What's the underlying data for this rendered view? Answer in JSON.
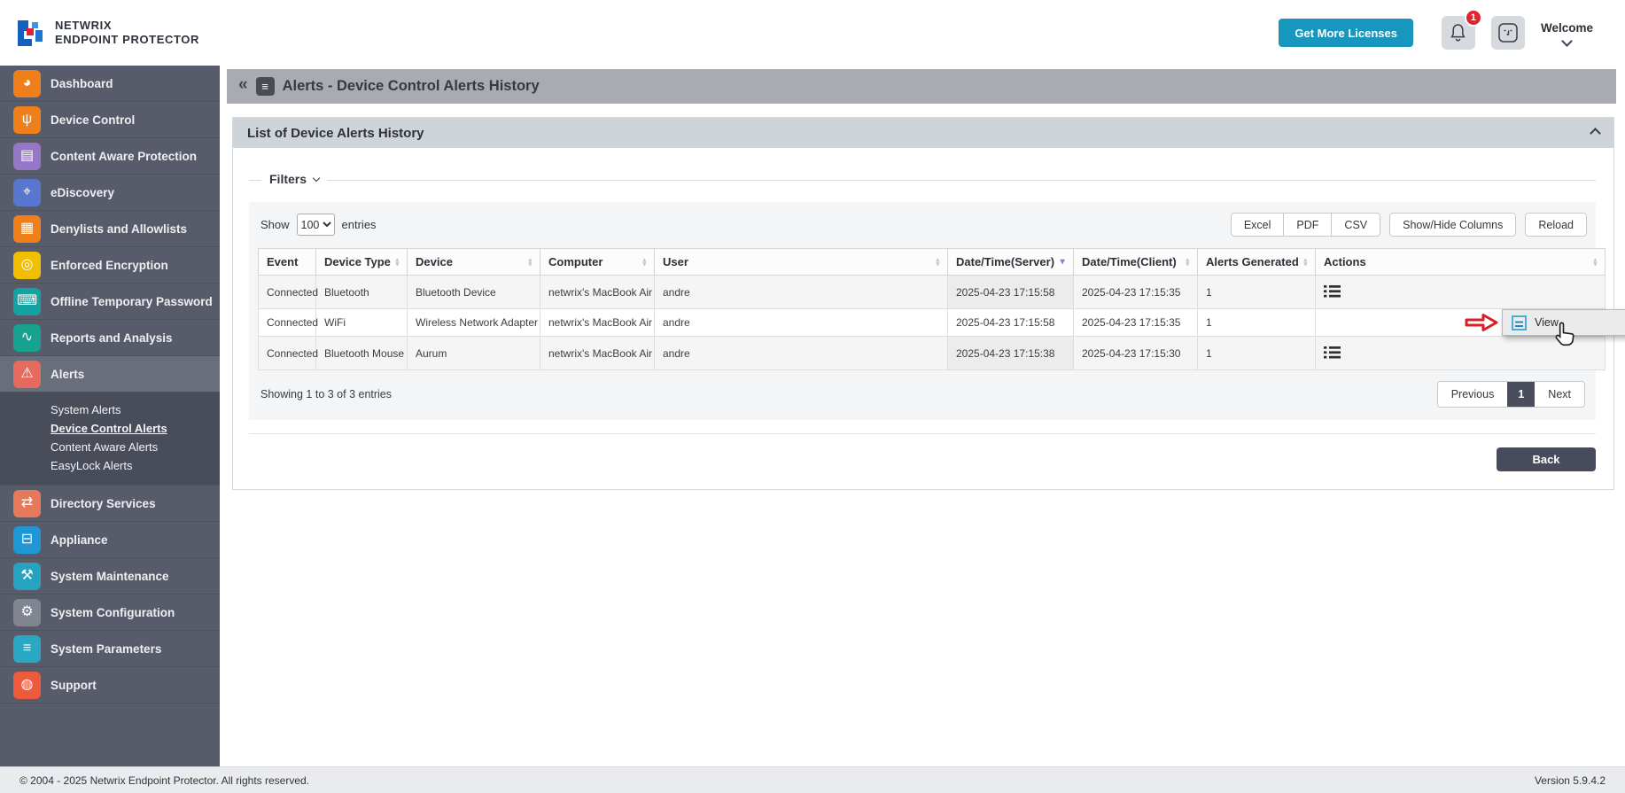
{
  "brand": {
    "line1": "NETWRIX",
    "line2": "ENDPOINT PROTECTOR"
  },
  "header": {
    "get_more_licenses": "Get More Licenses",
    "notification_count": "1",
    "welcome": "Welcome",
    "collapse_glyph": "«"
  },
  "sidebar": {
    "items": [
      {
        "label": "Dashboard",
        "icon": "pie-chart-icon",
        "glyph": "◕",
        "color": "#ef7f1a"
      },
      {
        "label": "Device Control",
        "icon": "usb-icon",
        "glyph": "ψ",
        "color": "#ef7f1a"
      },
      {
        "label": "Content Aware Protection",
        "icon": "document-scan-icon",
        "glyph": "▤",
        "color": "#9677c7"
      },
      {
        "label": "eDiscovery",
        "icon": "telescope-icon",
        "glyph": "⌖",
        "color": "#5a77d0"
      },
      {
        "label": "Denylists and Allowlists",
        "icon": "list-window-icon",
        "glyph": "▦",
        "color": "#ef7f1a"
      },
      {
        "label": "Enforced Encryption",
        "icon": "cd-icon",
        "glyph": "◎",
        "color": "#f2bf00"
      },
      {
        "label": "Offline Temporary Password",
        "icon": "keypad-icon",
        "glyph": "⌨",
        "color": "#14a3a3"
      },
      {
        "label": "Reports and Analysis",
        "icon": "chart-icon",
        "glyph": "∿",
        "color": "#16a28f"
      },
      {
        "label": "Alerts",
        "icon": "warning-icon",
        "glyph": "⚠",
        "color": "#e66a5e",
        "active": true,
        "children": [
          {
            "label": "System Alerts"
          },
          {
            "label": "Device Control Alerts",
            "active": true
          },
          {
            "label": "Content Aware Alerts"
          },
          {
            "label": "EasyLock Alerts"
          }
        ]
      },
      {
        "label": "Directory Services",
        "icon": "briefcase-sync-icon",
        "glyph": "⇄",
        "color": "#e5795a"
      },
      {
        "label": "Appliance",
        "icon": "server-icon",
        "glyph": "⊟",
        "color": "#1e97d4"
      },
      {
        "label": "System Maintenance",
        "icon": "tools-icon",
        "glyph": "⚒",
        "color": "#25a3c0"
      },
      {
        "label": "System Configuration",
        "icon": "gear-icon",
        "glyph": "⚙",
        "color": "#81858f"
      },
      {
        "label": "System Parameters",
        "icon": "list-settings-icon",
        "glyph": "≡",
        "color": "#2aa7c2"
      },
      {
        "label": "Support",
        "icon": "lifebuoy-icon",
        "glyph": "◍",
        "color": "#ed5a3c"
      }
    ]
  },
  "page": {
    "title": "Alerts - Device Control Alerts History",
    "doc_glyph": "≡"
  },
  "panel": {
    "title": "List of Device Alerts History"
  },
  "filters": {
    "label": "Filters"
  },
  "toolbar": {
    "show_label": "Show",
    "entries_value": "100",
    "entries_label": "entries",
    "export_buttons": [
      "Excel",
      "PDF",
      "CSV"
    ],
    "show_hide_columns": "Show/Hide Columns",
    "reload": "Reload"
  },
  "table": {
    "columns": [
      {
        "label": "Event",
        "sort": "none"
      },
      {
        "label": "Device Type",
        "sort": "both"
      },
      {
        "label": "Device",
        "sort": "both"
      },
      {
        "label": "Computer",
        "sort": "both"
      },
      {
        "label": "User",
        "sort": "both"
      },
      {
        "label": "Date/Time(Server)",
        "sort": "desc"
      },
      {
        "label": "Date/Time(Client)",
        "sort": "both"
      },
      {
        "label": "Alerts Generated",
        "sort": "both"
      },
      {
        "label": "Actions",
        "sort": "both"
      }
    ],
    "sorted_column_index": 5,
    "rows": [
      [
        "Connected",
        "Bluetooth",
        "Bluetooth Device",
        "netwrix's MacBook Air",
        "andre",
        "2025-04-23 17:15:58",
        "2025-04-23 17:15:35",
        "1"
      ],
      [
        "Connected",
        "WiFi",
        "Wireless Network Adapter",
        "netwrix's MacBook Air",
        "andre",
        "2025-04-23 17:15:58",
        "2025-04-23 17:15:35",
        "1"
      ],
      [
        "Connected",
        "Bluetooth Mouse",
        "Aurum",
        "netwrix's MacBook Air",
        "andre",
        "2025-04-23 17:15:38",
        "2025-04-23 17:15:30",
        "1"
      ]
    ]
  },
  "popup": {
    "view_label": "View"
  },
  "pagination": {
    "info": "Showing 1 to 3 of 3 entries",
    "previous": "Previous",
    "current_page": "1",
    "next": "Next"
  },
  "actions": {
    "back": "Back"
  },
  "footer": {
    "copyright": "© 2004 - 2025 Netwrix Endpoint Protector. All rights reserved.",
    "version": "Version 5.9.4.2"
  }
}
